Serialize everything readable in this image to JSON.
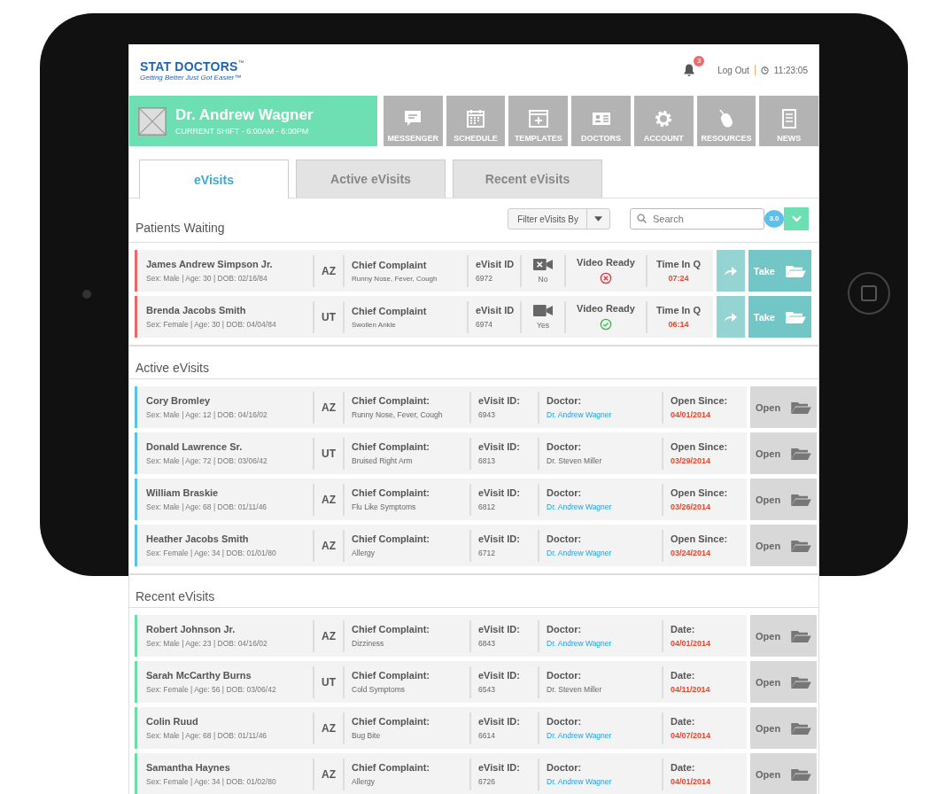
{
  "header": {
    "logo_title": "STAT DOCTORS",
    "logo_tm": "™",
    "logo_tagline": "Getting Better Just Got Easier™",
    "notification_count": "3",
    "logout": "Log Out",
    "time": "11:23:05"
  },
  "doctor": {
    "name": "Dr. Andrew Wagner",
    "shift": "CURRENT SHIFT - 6:00AM - 6:00PM"
  },
  "nav": [
    {
      "label": "MESSENGER",
      "kind": "chat"
    },
    {
      "label": "SCHEDULE",
      "kind": "calendar"
    },
    {
      "label": "TEMPLATES",
      "kind": "template"
    },
    {
      "label": "DOCTORS",
      "kind": "card"
    },
    {
      "label": "ACCOUNT",
      "kind": "gear"
    },
    {
      "label": "RESOURCES",
      "kind": "mouse"
    },
    {
      "label": "NEWS",
      "kind": "document"
    }
  ],
  "tabs": [
    {
      "label": "eVisits",
      "selected": true
    },
    {
      "label": "Active eVisits",
      "selected": false
    },
    {
      "label": "Recent eVisits",
      "selected": false
    }
  ],
  "filter": {
    "label": "Filter eVisits By",
    "search_placeholder": "Search",
    "badge": "3.0"
  },
  "waiting": {
    "title": "Patients Waiting",
    "color": "#e8676b",
    "rows": [
      {
        "name": "James Andrew Simpson Jr.",
        "info": "Sex: Male  |  Age: 30  |  DOB: 02/16/84",
        "state": "AZ",
        "complaint_label": "Chief Complaint",
        "complaint": "Runny Nose, Fever, Cough",
        "id_label": "eVisit ID",
        "id": "6972",
        "video_available": false,
        "video_text": "No",
        "ready_label": "Video Ready",
        "video_ready": false,
        "time_label": "Time In Q",
        "time": "07:24",
        "action": "Take"
      },
      {
        "name": "Brenda Jacobs Smith",
        "info": "Sex: Female  |  Age: 30  |  DOB: 04/04/84",
        "state": "UT",
        "complaint_label": "Chief Complaint",
        "complaint": "Swollen Ankle",
        "id_label": "eVisit ID",
        "id": "6974",
        "video_available": true,
        "video_text": "Yes",
        "ready_label": "Video Ready",
        "video_ready": true,
        "time_label": "Time In Q",
        "time": "06:14",
        "action": "Take"
      }
    ]
  },
  "lists": [
    {
      "title": "Active eVisits",
      "color": "#5bc0e8",
      "rows": [
        {
          "name": "Cory Bromley",
          "info": "Sex: Male  |  Age: 12  |  DOB: 04/16/02",
          "state": "AZ",
          "complaint_label": "Chief Complaint:",
          "complaint": "Runny Nose, Fever, Cough",
          "id_label": "eVisit ID:",
          "id": "6943",
          "doctor_label": "Doctor:",
          "doctor": "Dr. Andrew Wagner",
          "doctor_highlighted": true,
          "date_label": "Open Since:",
          "date": "04/01/2014",
          "action": "Open"
        },
        {
          "name": "Donald Lawrence Sr.",
          "info": "Sex: Male  |  Age: 72  |  DOB: 03/06/42",
          "state": "UT",
          "complaint_label": "Chief Complaint:",
          "complaint": "Bruised Right Arm",
          "id_label": "eVisit ID:",
          "id": "6813",
          "doctor_label": "Doctor:",
          "doctor": "Dr. Steven Miller",
          "doctor_highlighted": false,
          "date_label": "Open Since:",
          "date": "03/29/2014",
          "action": "Open"
        },
        {
          "name": "William Braskie",
          "info": "Sex: Male  |  Age: 68  |  DOB: 01/11/46",
          "state": "AZ",
          "complaint_label": "Chief Complaint:",
          "complaint": "Flu Like Symptoms",
          "id_label": "eVisit ID:",
          "id": "6812",
          "doctor_label": "Doctor:",
          "doctor": "Dr. Andrew Wagner",
          "doctor_highlighted": true,
          "date_label": "Open Since:",
          "date": "03/26/2014",
          "action": "Open"
        },
        {
          "name": "Heather Jacobs Smith",
          "info": "Sex: Female  |  Age: 34  |  DOB: 01/01/80",
          "state": "AZ",
          "complaint_label": "Chief Complaint:",
          "complaint": "Allergy",
          "id_label": "eVisit ID:",
          "id": "6712",
          "doctor_label": "Doctor:",
          "doctor": "Dr. Andrew Wagner",
          "doctor_highlighted": true,
          "date_label": "Open Since:",
          "date": "03/24/2014",
          "action": "Open"
        }
      ]
    },
    {
      "title": "Recent eVisits",
      "color": "#6ddba9",
      "rows": [
        {
          "name": "Robert Johnson Jr.",
          "info": "Sex: Male  |  Age: 23  |  DOB: 04/16/02",
          "state": "AZ",
          "complaint_label": "Chief Complaint:",
          "complaint": "Dizziness",
          "id_label": "eVisit ID:",
          "id": "6843",
          "doctor_label": "Doctor:",
          "doctor": "Dr. Andrew Wagner",
          "doctor_highlighted": true,
          "date_label": "Date:",
          "date": "04/01/2014",
          "action": "Open"
        },
        {
          "name": "Sarah McCarthy Burns",
          "info": "Sex: Female  |  Age: 56  |  DOB: 03/06/42",
          "state": "UT",
          "complaint_label": "Chief Complaint:",
          "complaint": "Cold Symptoms",
          "id_label": "eVisit ID:",
          "id": "6543",
          "doctor_label": "Doctor:",
          "doctor": "Dr. Steven Miller",
          "doctor_highlighted": false,
          "date_label": "Date:",
          "date": "04/11/2014",
          "action": "Open"
        },
        {
          "name": "Colin Ruud",
          "info": "Sex: Male  |  Age: 68  |  DOB: 01/11/46",
          "state": "AZ",
          "complaint_label": "Chief Complaint:",
          "complaint": "Bug Bite",
          "id_label": "eVisit ID:",
          "id": "6614",
          "doctor_label": "Doctor:",
          "doctor": "Dr. Andrew Wagner",
          "doctor_highlighted": true,
          "date_label": "Date:",
          "date": "04/07/2014",
          "action": "Open"
        },
        {
          "name": "Samantha Haynes",
          "info": "Sex: Female  |  Age: 34  |  DOB: 01/02/80",
          "state": "AZ",
          "complaint_label": "Chief Complaint:",
          "complaint": "Allergy",
          "id_label": "eVisit ID:",
          "id": "6726",
          "doctor_label": "Doctor:",
          "doctor": "Dr. Andrew Wagner",
          "doctor_highlighted": true,
          "date_label": "Date:",
          "date": "04/01/2014",
          "action": "Open"
        }
      ]
    }
  ]
}
